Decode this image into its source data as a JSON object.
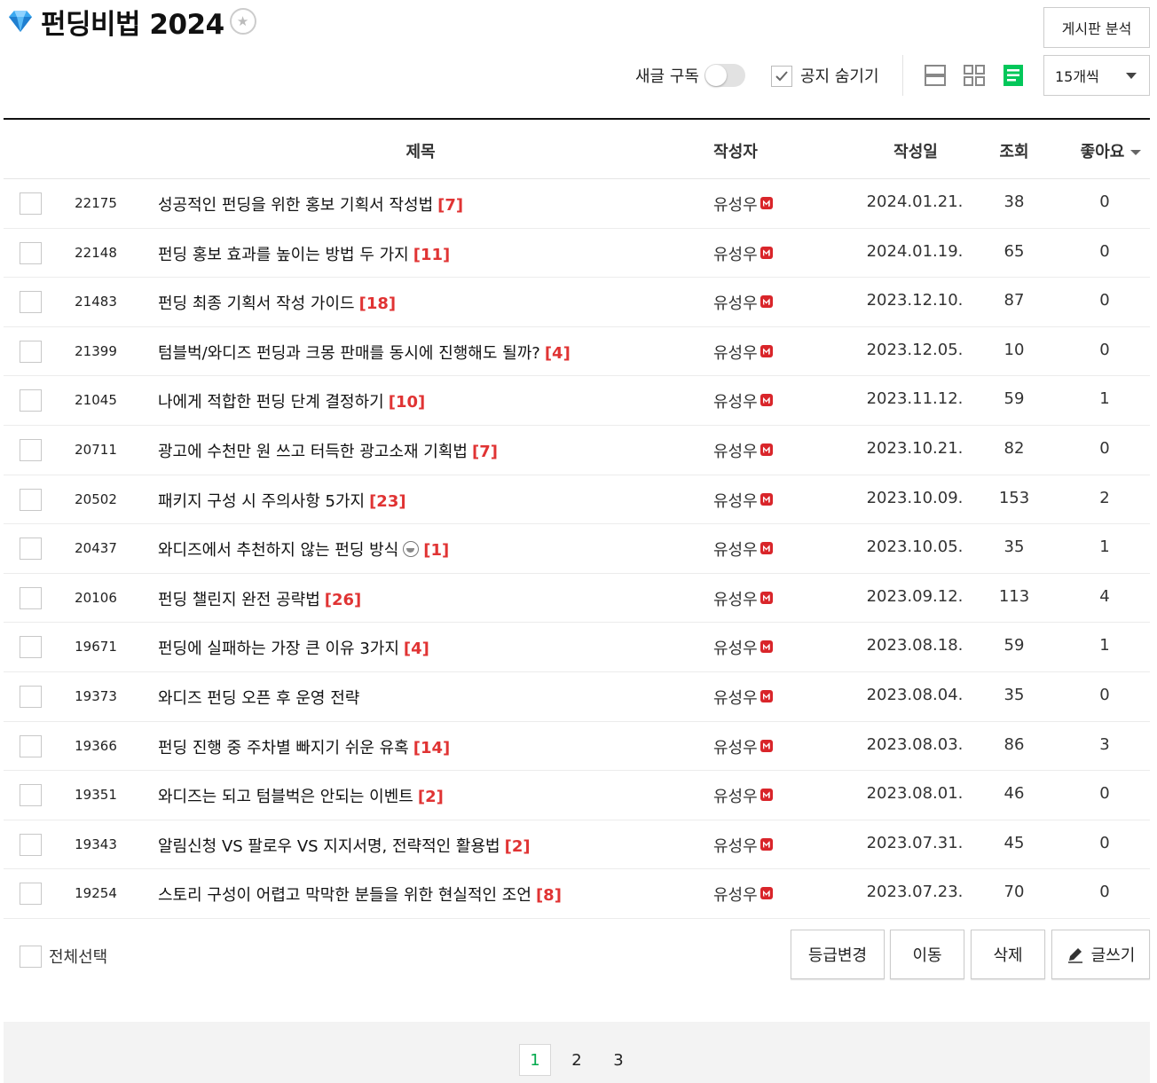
{
  "header": {
    "title": "펀딩비법 2024",
    "analyze_label": "게시판 분석"
  },
  "controls": {
    "subscribe_label": "새글 구독",
    "subscribe_on": false,
    "hide_notice_label": "공지 숨기기",
    "hide_notice_checked": true,
    "per_page_label": "15개씩",
    "active_view": "list",
    "accent_color": "#03c75a"
  },
  "table": {
    "headers": {
      "subject": "제목",
      "author": "작성자",
      "date": "작성일",
      "views": "조회",
      "likes": "좋아요"
    },
    "rows": [
      {
        "num": "22175",
        "subject": "성공적인 펀딩을 위한 홍보 기획서 작성법",
        "comments": "[7]",
        "author": "유성우",
        "date": "2024.01.21.",
        "views": "38",
        "likes": "0"
      },
      {
        "num": "22148",
        "subject": "펀딩 홍보 효과를 높이는 방법 두 가지",
        "comments": "[11]",
        "author": "유성우",
        "date": "2024.01.19.",
        "views": "65",
        "likes": "0"
      },
      {
        "num": "21483",
        "subject": "펀딩 최종 기획서 작성 가이드",
        "comments": "[18]",
        "author": "유성우",
        "date": "2023.12.10.",
        "views": "87",
        "likes": "0"
      },
      {
        "num": "21399",
        "subject": "텀블벅/와디즈 펀딩과 크몽 판매를 동시에 진행해도 될까?",
        "comments": "[4]",
        "author": "유성우",
        "date": "2023.12.05.",
        "views": "10",
        "likes": "0"
      },
      {
        "num": "21045",
        "subject": "나에게 적합한 펀딩 단계 결정하기",
        "comments": "[10]",
        "author": "유성우",
        "date": "2023.11.12.",
        "views": "59",
        "likes": "1"
      },
      {
        "num": "20711",
        "subject": "광고에 수천만 원 쓰고 터득한 광고소재 기획법",
        "comments": "[7]",
        "author": "유성우",
        "date": "2023.10.21.",
        "views": "82",
        "likes": "0"
      },
      {
        "num": "20502",
        "subject": "패키지 구성 시 주의사항 5가지",
        "comments": "[23]",
        "author": "유성우",
        "date": "2023.10.09.",
        "views": "153",
        "likes": "2"
      },
      {
        "num": "20437",
        "subject": "와디즈에서 추천하지 않는 펀딩 방식",
        "emoji": true,
        "comments": "[1]",
        "author": "유성우",
        "date": "2023.10.05.",
        "views": "35",
        "likes": "1"
      },
      {
        "num": "20106",
        "subject": "펀딩 챌린지 완전 공략법",
        "comments": "[26]",
        "author": "유성우",
        "date": "2023.09.12.",
        "views": "113",
        "likes": "4"
      },
      {
        "num": "19671",
        "subject": "펀딩에 실패하는 가장 큰 이유 3가지",
        "comments": "[4]",
        "author": "유성우",
        "date": "2023.08.18.",
        "views": "59",
        "likes": "1"
      },
      {
        "num": "19373",
        "subject": "와디즈 펀딩 오픈 후 운영 전략",
        "comments": "",
        "author": "유성우",
        "date": "2023.08.04.",
        "views": "35",
        "likes": "0"
      },
      {
        "num": "19366",
        "subject": "펀딩 진행 중 주차별 빠지기 쉬운 유혹",
        "comments": "[14]",
        "author": "유성우",
        "date": "2023.08.03.",
        "views": "86",
        "likes": "3"
      },
      {
        "num": "19351",
        "subject": "와디즈는 되고 텀블벅은 안되는 이벤트",
        "comments": "[2]",
        "author": "유성우",
        "date": "2023.08.01.",
        "views": "46",
        "likes": "0"
      },
      {
        "num": "19343",
        "subject": "알림신청 VS 팔로우 VS 지지서명, 전략적인 활용법",
        "comments": "[2]",
        "author": "유성우",
        "date": "2023.07.31.",
        "views": "45",
        "likes": "0"
      },
      {
        "num": "19254",
        "subject": "스토리 구성이 어렵고 막막한 분들을 위한 현실적인 조언",
        "comments": "[8]",
        "author": "유성우",
        "date": "2023.07.23.",
        "views": "70",
        "likes": "0"
      }
    ]
  },
  "footer": {
    "select_all_label": "전체선택",
    "grade_label": "등급변경",
    "move_label": "이동",
    "delete_label": "삭제",
    "write_label": "글쓰기"
  },
  "pagination": {
    "pages": [
      "1",
      "2",
      "3"
    ],
    "current": "1"
  }
}
